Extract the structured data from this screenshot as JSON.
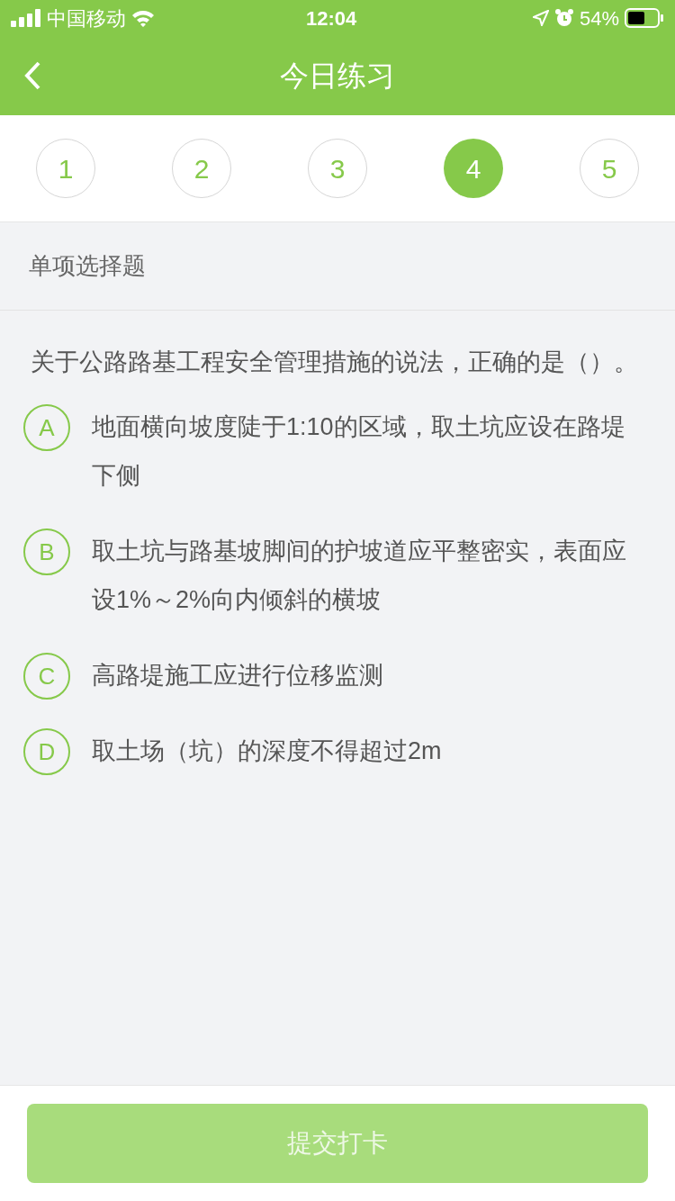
{
  "status_bar": {
    "carrier": "中国移动",
    "time": "12:04",
    "battery": "54%"
  },
  "header": {
    "title": "今日练习"
  },
  "steps": [
    {
      "label": "1",
      "selected": false
    },
    {
      "label": "2",
      "selected": false
    },
    {
      "label": "3",
      "selected": false
    },
    {
      "label": "4",
      "selected": true
    },
    {
      "label": "5",
      "selected": false
    }
  ],
  "section_label": "单项选择题",
  "question": "关于公路路基工程安全管理措施的说法，正确的是（）。",
  "options": [
    {
      "letter": "A",
      "text": "地面横向坡度陡于1:10的区域，取土坑应设在路堤下侧"
    },
    {
      "letter": "B",
      "text": "取土坑与路基坡脚间的护坡道应平整密实，表面应设1%～2%向内倾斜的横坡"
    },
    {
      "letter": "C",
      "text": "高路堤施工应进行位移监测"
    },
    {
      "letter": "D",
      "text": "取土场（坑）的深度不得超过2m"
    }
  ],
  "submit": {
    "label": "提交打卡",
    "disabled": true
  }
}
